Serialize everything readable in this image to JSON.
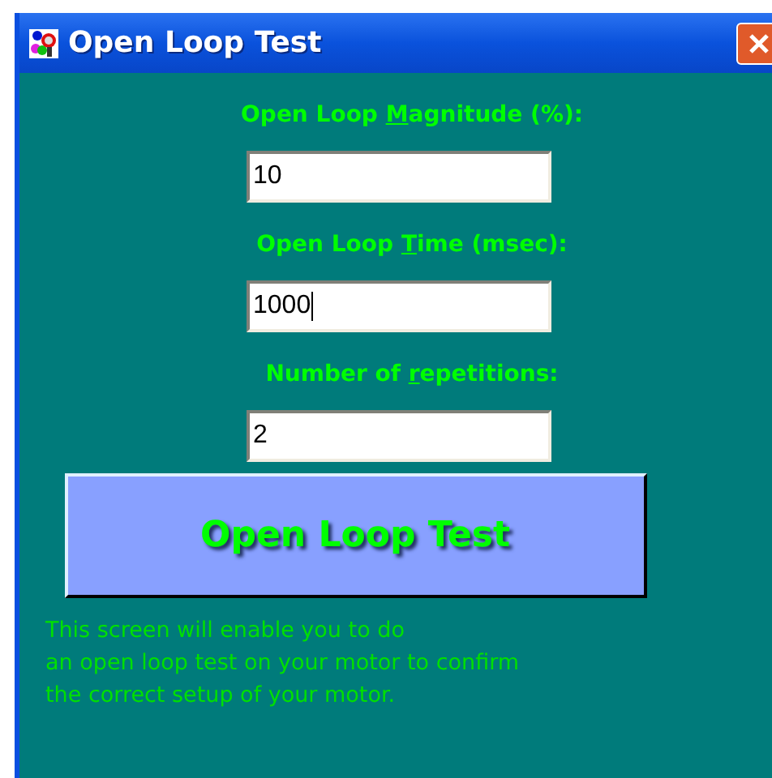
{
  "window": {
    "title": "Open Loop Test"
  },
  "fields": [
    {
      "label_start": "Open Loop ",
      "access_key": "M",
      "label_end": "agnitude (%):",
      "value": "10",
      "focused": false
    },
    {
      "label_start": "Open Loop ",
      "access_key": "T",
      "label_end": "ime (msec):",
      "value": "1000",
      "focused": true
    },
    {
      "label_start": "Number of ",
      "access_key": "r",
      "label_end": "epetitions:",
      "value": "2",
      "focused": false
    }
  ],
  "run_button": {
    "label": "Open Loop Test"
  },
  "description": [
    "This screen will enable you to do",
    "an open loop test on your motor to confirm",
    "the correct setup of your motor."
  ]
}
